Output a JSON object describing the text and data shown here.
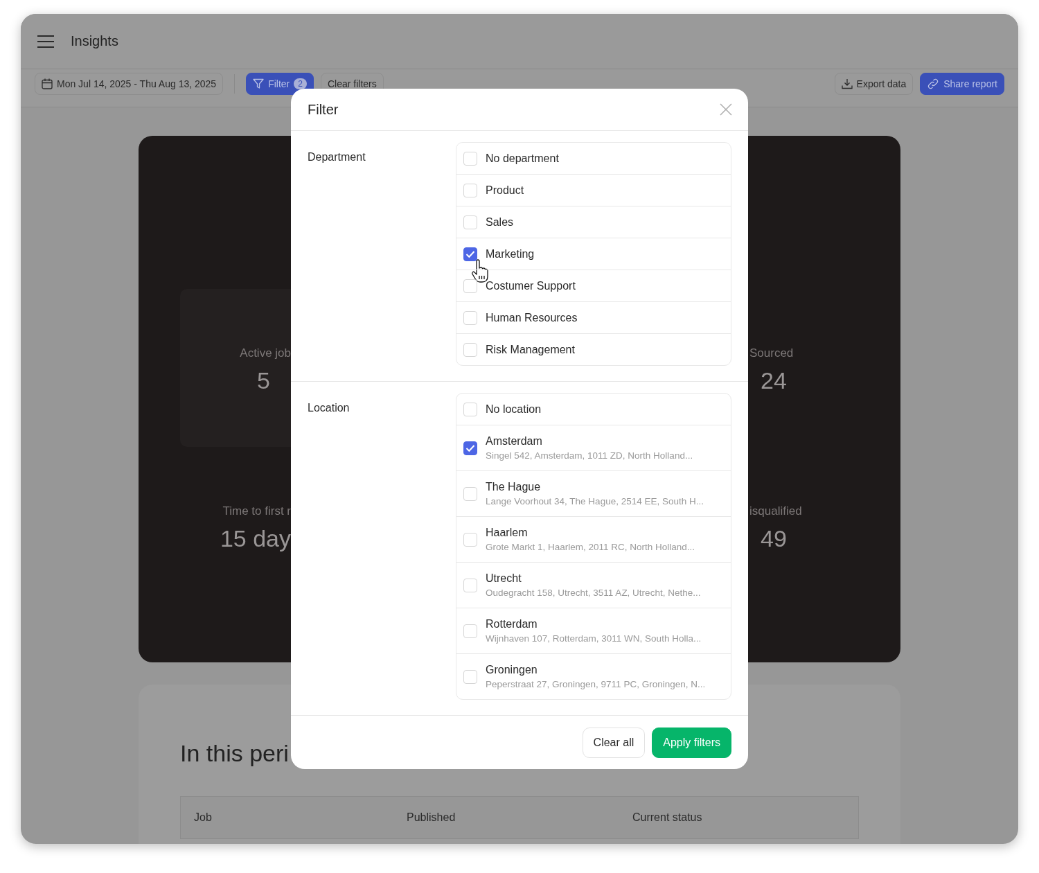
{
  "app": {
    "title": "Insights"
  },
  "toolbar": {
    "date_range": "Mon Jul 14, 2025 - Thu Aug 13, 2025",
    "filter": {
      "label": "Filter",
      "count": "2"
    },
    "clear": "Clear filters",
    "export": "Export data",
    "share": "Share report"
  },
  "stats_left": [
    {
      "label": "Active job",
      "value": "5",
      "kind": "card"
    },
    {
      "label": "Time to first r",
      "value": "15 day",
      "kind": "plain"
    }
  ],
  "stats_right": [
    {
      "label": "Sourced",
      "value": "24"
    },
    {
      "label": "isqualified",
      "value": "49"
    }
  ],
  "period": {
    "title": "In this peri",
    "columns": [
      "Job",
      "Published",
      "Current status"
    ]
  },
  "dialog": {
    "title": "Filter",
    "groups": [
      {
        "label": "Department",
        "options": [
          {
            "name": "No department",
            "checked": false
          },
          {
            "name": "Product",
            "checked": false
          },
          {
            "name": "Sales",
            "checked": false
          },
          {
            "name": "Marketing",
            "checked": true
          },
          {
            "name": "Costumer Support",
            "checked": false
          },
          {
            "name": "Human Resources",
            "checked": false
          },
          {
            "name": "Risk Management",
            "checked": false
          }
        ]
      },
      {
        "label": "Location",
        "options": [
          {
            "name": "No location",
            "checked": false
          },
          {
            "name": "Amsterdam",
            "address": "Singel 542, Amsterdam, 1011 ZD, North Holland...",
            "checked": true
          },
          {
            "name": "The Hague",
            "address": "Lange Voorhout 34, The Hague, 2514 EE, South H...",
            "checked": false
          },
          {
            "name": "Haarlem",
            "address": "Grote Markt 1, Haarlem, 2011 RC, North Holland...",
            "checked": false
          },
          {
            "name": "Utrecht",
            "address": "Oudegracht 158, Utrecht, 3511 AZ, Utrecht, Nethe...",
            "checked": false
          },
          {
            "name": "Rotterdam",
            "address": "Wijnhaven 107, Rotterdam, 3011 WN, South Holla...",
            "checked": false
          },
          {
            "name": "Groningen",
            "address": "Peperstraat 27, Groningen, 9711 PC, Groningen, N...",
            "checked": false
          }
        ]
      }
    ],
    "buttons": [
      {
        "label": "Clear all",
        "kind": "secondary"
      },
      {
        "label": "Apply filters",
        "kind": "primary"
      }
    ]
  }
}
